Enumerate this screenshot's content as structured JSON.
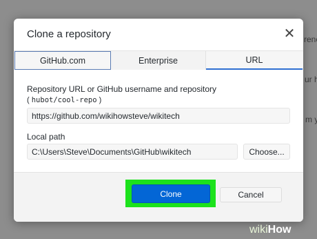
{
  "dialog": {
    "title": "Clone a repository",
    "close_icon": "close-icon",
    "close_glyph": "✕"
  },
  "tabs": [
    {
      "label": "GitHub.com"
    },
    {
      "label": "Enterprise"
    },
    {
      "label": "URL",
      "selected": true
    }
  ],
  "url_section": {
    "label": "Repository URL or GitHub username and repository",
    "hint_open": "(",
    "hint_code": "hubot/cool-repo",
    "hint_close": ")",
    "value": "https://github.com/wikihowsteve/wikitech"
  },
  "path_section": {
    "label": "Local path",
    "value": "C:\\Users\\Steve\\Documents\\GitHub\\wikitech",
    "choose_label": "Choose..."
  },
  "footer": {
    "clone_label": "Clone",
    "cancel_label": "Cancel"
  },
  "background_snippets": {
    "line1": "rener",
    "line2": "ur ho",
    "line3": "m you"
  },
  "watermark": {
    "wiki": "wiki",
    "how": "How"
  },
  "colors": {
    "accent": "#0366d6",
    "highlight": "#1ce21c",
    "tab_underline": "#2f6fd1"
  }
}
